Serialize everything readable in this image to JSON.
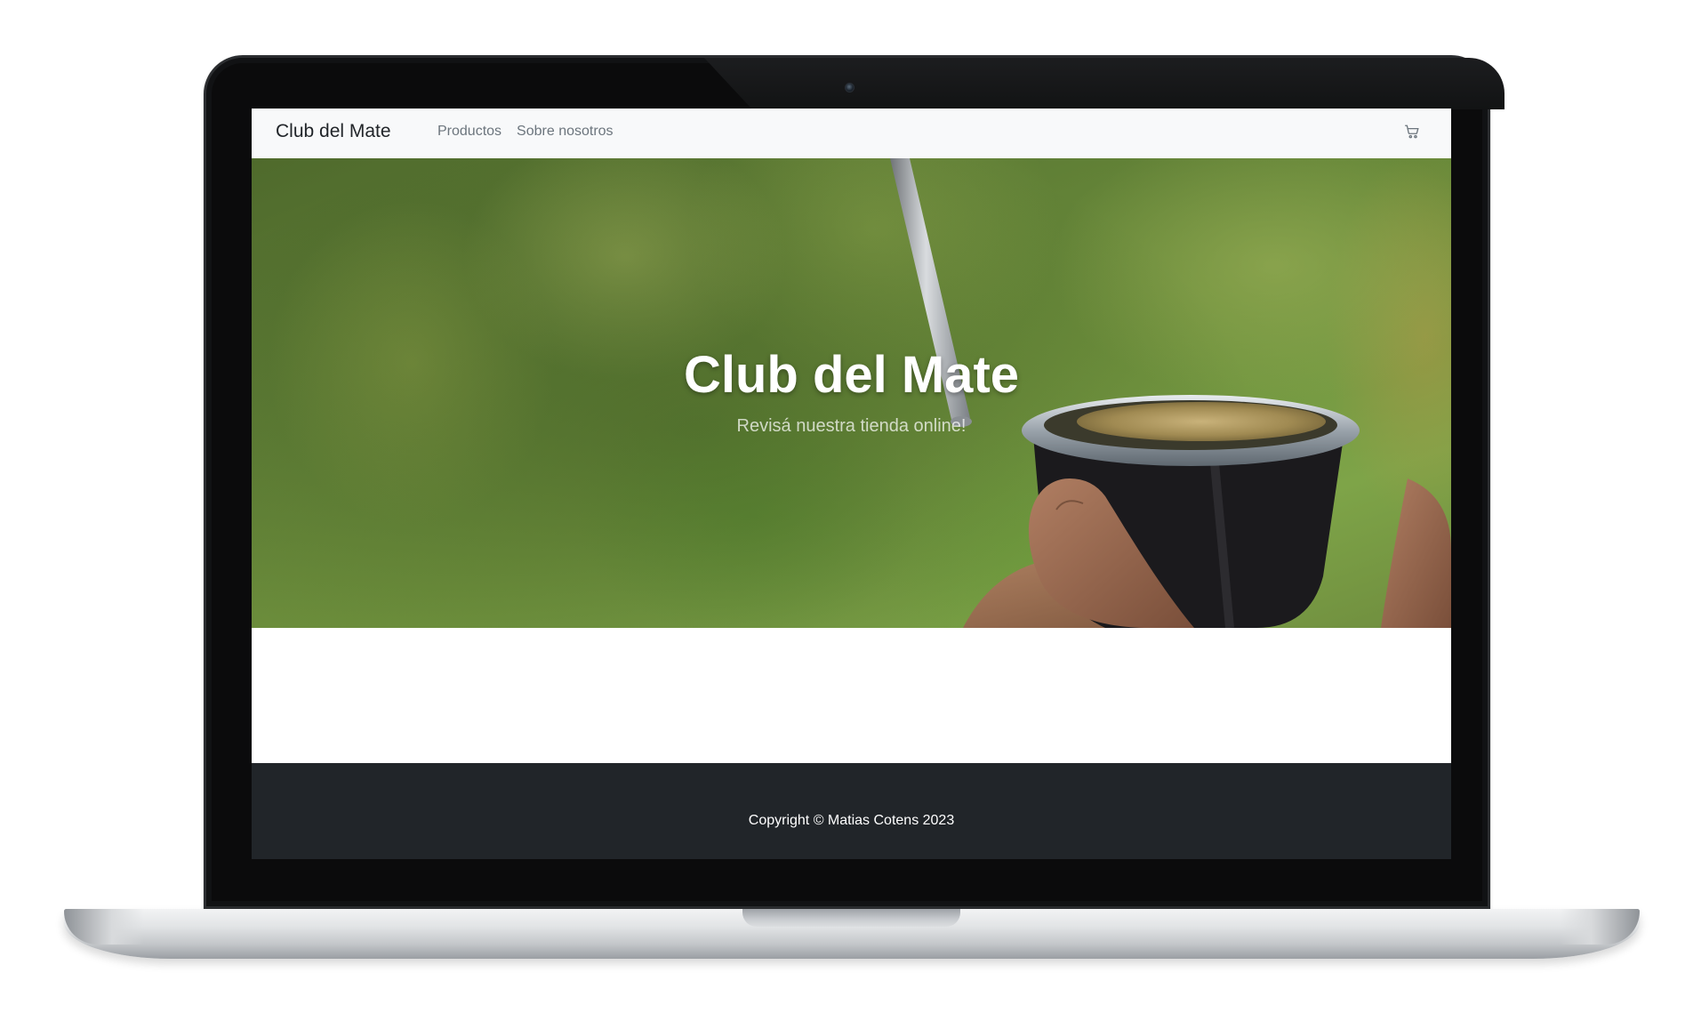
{
  "navbar": {
    "brand": "Club del Mate",
    "links": [
      "Productos",
      "Sobre nosotros"
    ],
    "cart_icon": "cart-icon"
  },
  "hero": {
    "title": "Club del Mate",
    "subtitle": "Revisá nuestra tienda online!"
  },
  "footer": {
    "copyright": "Copyright © Matias Cotens 2023"
  },
  "colors": {
    "navbar_bg": "#f8f9fa",
    "footer_bg": "#212529",
    "text_dark": "#212529",
    "text_muted": "#6c757d"
  }
}
